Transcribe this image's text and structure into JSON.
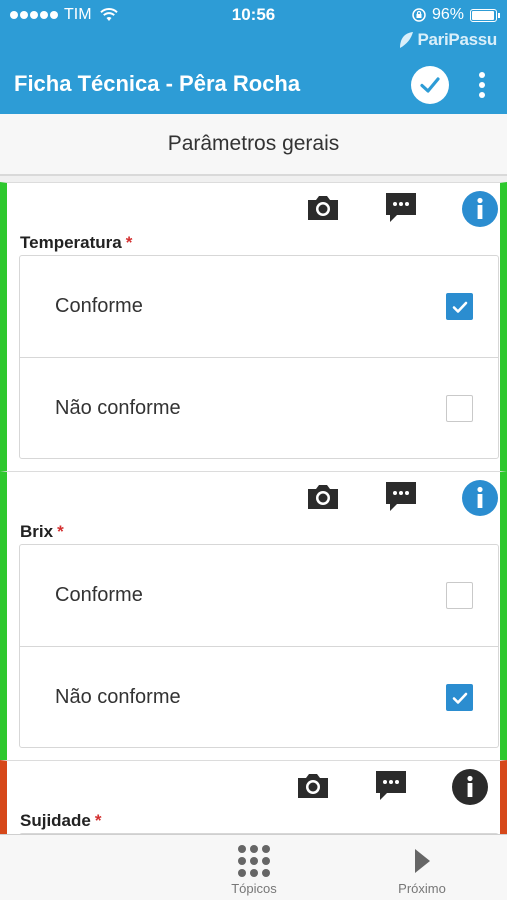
{
  "status_bar": {
    "carrier": "TIM",
    "time": "10:56",
    "battery_text": "96%",
    "battery_level": 0.96
  },
  "brand": {
    "name": "PariPassu"
  },
  "header": {
    "title": "Ficha Técnica - Pêra Rocha"
  },
  "section": {
    "title": "Parâmetros gerais"
  },
  "colors": {
    "primary": "#2d9cd6",
    "ok_border": "#2ec82e",
    "nok_border": "#d6481a",
    "checkbox_on": "#2b8dd0",
    "required": "#d32f2f"
  },
  "questions": [
    {
      "label": "Temperatura",
      "required_mark": "*",
      "options": [
        {
          "label": "Conforme",
          "checked": true
        },
        {
          "label": "Não conforme",
          "checked": false
        }
      ]
    },
    {
      "label": "Brix",
      "required_mark": "*",
      "options": [
        {
          "label": "Conforme",
          "checked": false
        },
        {
          "label": "Não conforme",
          "checked": true
        }
      ]
    },
    {
      "label": "Sujidade",
      "required_mark": "*"
    }
  ],
  "bottom_nav": {
    "topics_label": "Tópicos",
    "next_label": "Próximo"
  }
}
